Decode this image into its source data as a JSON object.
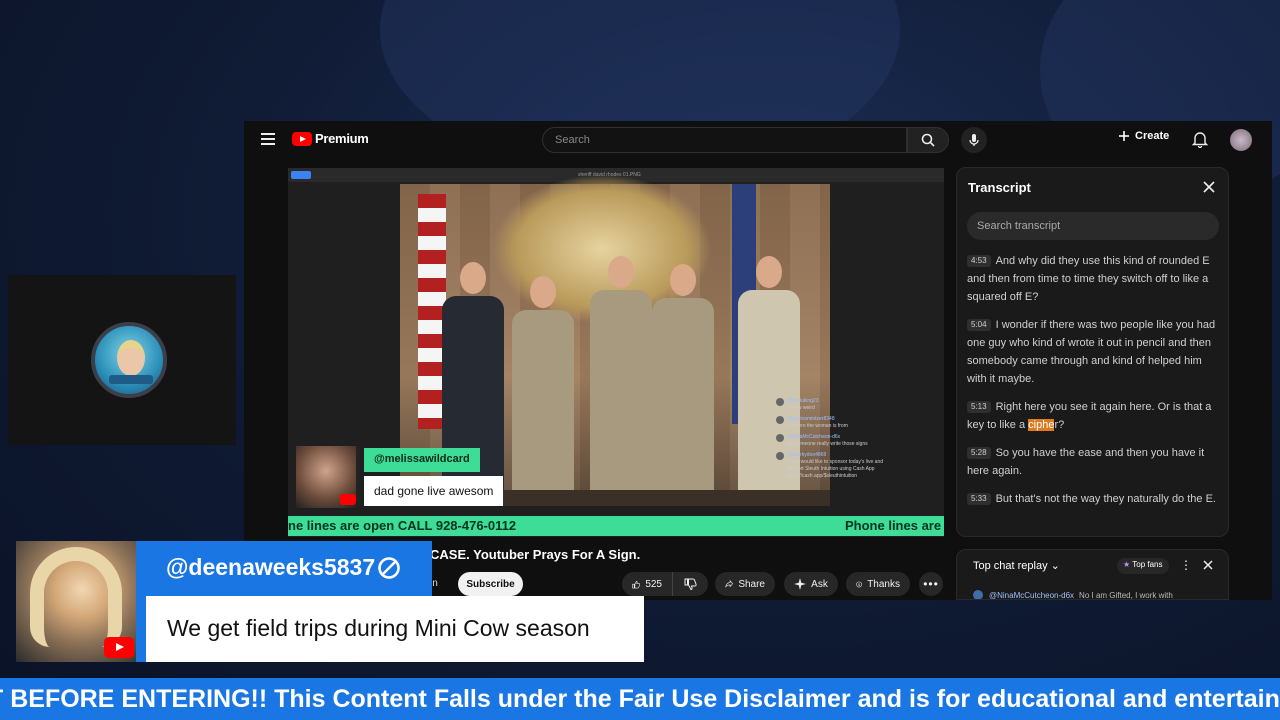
{
  "youtube": {
    "logo_text": "Premium",
    "search_placeholder": "Search",
    "create_label": "Create",
    "video_title": "CASE. Youtuber Prays For A Sign.",
    "join_label": "in",
    "subscribe_label": "Subscribe",
    "like_count": "525",
    "share_label": "Share",
    "ask_label": "Ask",
    "thanks_label": "Thanks"
  },
  "player": {
    "window_title": "sheriff david rhodes 01.PNG",
    "chat_overlay": [
      {
        "name": "@kcoluking23",
        "text": "I know weird"
      },
      {
        "name": "@laurinamintzer8348",
        "text": "is where the woman is from"
      },
      {
        "name": "@NinaMcCutcheon-d6x",
        "text": "did someone really write those signs"
      },
      {
        "name": "@sparkydoo4869",
        "text": "If you would like to sponsor today's live and support Sleuth Intuition using Cash App https://cash.app/$sleuthintuition"
      }
    ],
    "featured_chat": {
      "name": "@melissawildcard",
      "text": "dad gone live awesom"
    },
    "ticker_left": "ne lines are open CALL 928-476-0112",
    "ticker_right": "Phone lines are"
  },
  "transcript": {
    "title": "Transcript",
    "search_placeholder": "Search transcript",
    "segments": [
      {
        "time": "4:53",
        "text": "And why did they use this kind of rounded E and then from time to time they switch off to like a squared off E?"
      },
      {
        "time": "5:04",
        "text": "I wonder if there was two people like you had one guy who kind of wrote it out in pencil and then somebody came through and kind of helped him with it maybe."
      },
      {
        "time": "5:13",
        "text_before": "Right here you see it again here. Or is that a key to like a ",
        "highlight": "ciphe",
        "text_after": "r?"
      },
      {
        "time": "5:28",
        "text": "So you have the ease and then you have it here again."
      },
      {
        "time": "5:33",
        "text": "But that's not the way they naturally do the E."
      }
    ]
  },
  "chat_replay": {
    "title": "Top chat replay",
    "fans_label": "Top fans",
    "last_msg_name": "@NinaMcCutcheon-d6x",
    "last_msg_text": "No I am Gifted, I work with"
  },
  "lower_third": {
    "username": "@deenaweeks5837",
    "message": "We get field trips during Mini Cow season"
  },
  "disclaimer": "T BEFORE ENTERING!! This Content Falls under the Fair Use Disclaimer and is for educational and entertainm",
  "colors": {
    "stream_blue": "#1976e3",
    "ticker_green": "#3ddc97",
    "youtube_red": "#ff0000",
    "highlight_orange": "#e07a1f"
  }
}
